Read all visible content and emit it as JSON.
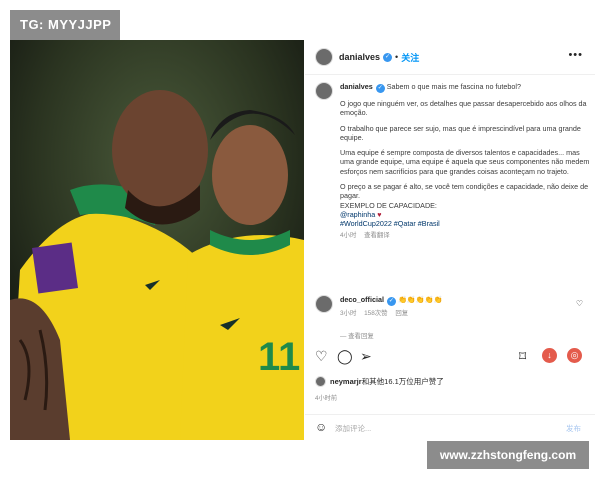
{
  "watermark_top": "TG: MYYJJPP",
  "watermark_bottom": "www.zzhstongfeng.com",
  "post": {
    "username": "danialves",
    "follow_label": "关注",
    "more_icon": "more-horizontal-icon",
    "caption_lines": [
      "Sabem o que mais me fascina no futebol?",
      "O jogo que ninguém ver, os detalhes que passar desapercebido aos olhos da emoção.",
      "O trabalho que parece ser sujo, mas que é imprescindível para uma grande equipe.",
      "Uma equipe é sempre composta de diversos talentos e capacidades... mas uma grande equipe, uma equipe é aquela que seus componentes não medem esforços nem sacrifícios para que grandes coisas aconteçam no trajeto.",
      "O preço a se pagar é alto, se você tem condições e capacidade, não deixe de pagar.",
      "EXEMPLO DE CAPACIDADE:"
    ],
    "mention": "@raphinha",
    "hashtags": "#WorldCup2022 #Qatar #Brasil",
    "caption_time": "4小时",
    "see_translation": "查看翻译",
    "jersey_number": "11",
    "colors": {
      "jersey_yellow": "#f2d21b",
      "jersey_green": "#1f8a4a",
      "link_blue": "#00376b",
      "brand_blue": "#0095f6"
    }
  },
  "comment": {
    "username": "deco_official",
    "text": "👏👏👏👏👏",
    "time": "3小时",
    "likes": "158次赞",
    "reply": "回复",
    "view_replies": "查看回复"
  },
  "actions": {
    "like_icon": "heart-icon",
    "comment_icon": "comment-icon",
    "share_icon": "send-icon",
    "save_icon": "bookmark-icon"
  },
  "liked_by": {
    "user": "neymarjr",
    "text": "和其他16.1万位用户赞了"
  },
  "post_time": "4小时前",
  "add_comment": {
    "placeholder": "添加评论...",
    "post_label": "发布"
  }
}
